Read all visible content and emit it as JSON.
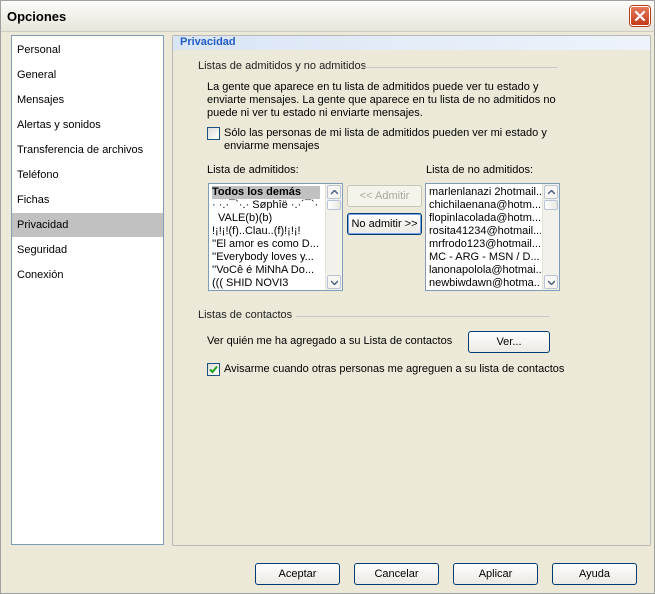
{
  "window": {
    "title": "Opciones"
  },
  "sidebar": {
    "items": [
      {
        "label": "Personal"
      },
      {
        "label": "General"
      },
      {
        "label": "Mensajes"
      },
      {
        "label": "Alertas y sonidos"
      },
      {
        "label": "Transferencia de archivos"
      },
      {
        "label": "Teléfono"
      },
      {
        "label": "Fichas"
      },
      {
        "label": "Privacidad",
        "selected": true
      },
      {
        "label": "Seguridad"
      },
      {
        "label": "Conexión"
      }
    ]
  },
  "panel": {
    "title": "Privacidad",
    "allow_section": {
      "heading": "Listas de admitidos y no admitidos",
      "description_lines": [
        "La gente que aparece en tu lista de admitidos puede ver tu estado y",
        "enviarte mensajes. La gente que aparece en tu lista de no admitidos no",
        "puede ni ver tu estado ni enviarte mensajes."
      ],
      "only_allowed_checkbox": {
        "lines": [
          "Sólo las personas de mi lista de admitidos pueden ver mi estado y",
          "enviarme mensajes"
        ],
        "checked": false
      },
      "allow_list_label": "Lista de admitidos:",
      "block_list_label": "Lista de no admitidos:",
      "allow_list": [
        "Todos los demás",
        "· ·.·¯`·.· Søphîë ·.·´¯`·",
        "VALE(b)(b)",
        "!¡!¡!(f)..Clau..(f)!¡!¡!",
        "''El amor es como D...",
        "''Everybody loves y...",
        "''VoCê é MiNhA Do...",
        "((( SHID NOVI3"
      ],
      "block_list": [
        "marlenlanazi 2hotmail...",
        "chichilaenana@hotm...",
        "flopinlacolada@hotm...",
        "rosita41234@hotmail...",
        "mrfrodo123@hotmail...",
        "MC - ARG - MSN / D...",
        "lanonapolola@hotmai...",
        "newbiwdawn@hotma..."
      ],
      "admit_button": "<< Admitir",
      "block_button": "No admitir >>"
    },
    "contacts_section": {
      "heading": "Listas de contactos",
      "who_added_label": "Ver quién me ha agregado a su Lista de contactos",
      "view_button": "Ver...",
      "notify_checkbox": {
        "label": "Avisarme cuando otras personas me agreguen a su lista de contactos",
        "checked": true
      }
    }
  },
  "footer": {
    "accept": "Aceptar",
    "cancel": "Cancelar",
    "apply": "Aplicar",
    "help": "Ayuda"
  },
  "colors": {
    "selection": "#c1c1c1",
    "panel_title": "#215dc6",
    "close_button": "#c4391b",
    "checkmark": "#21a121"
  }
}
